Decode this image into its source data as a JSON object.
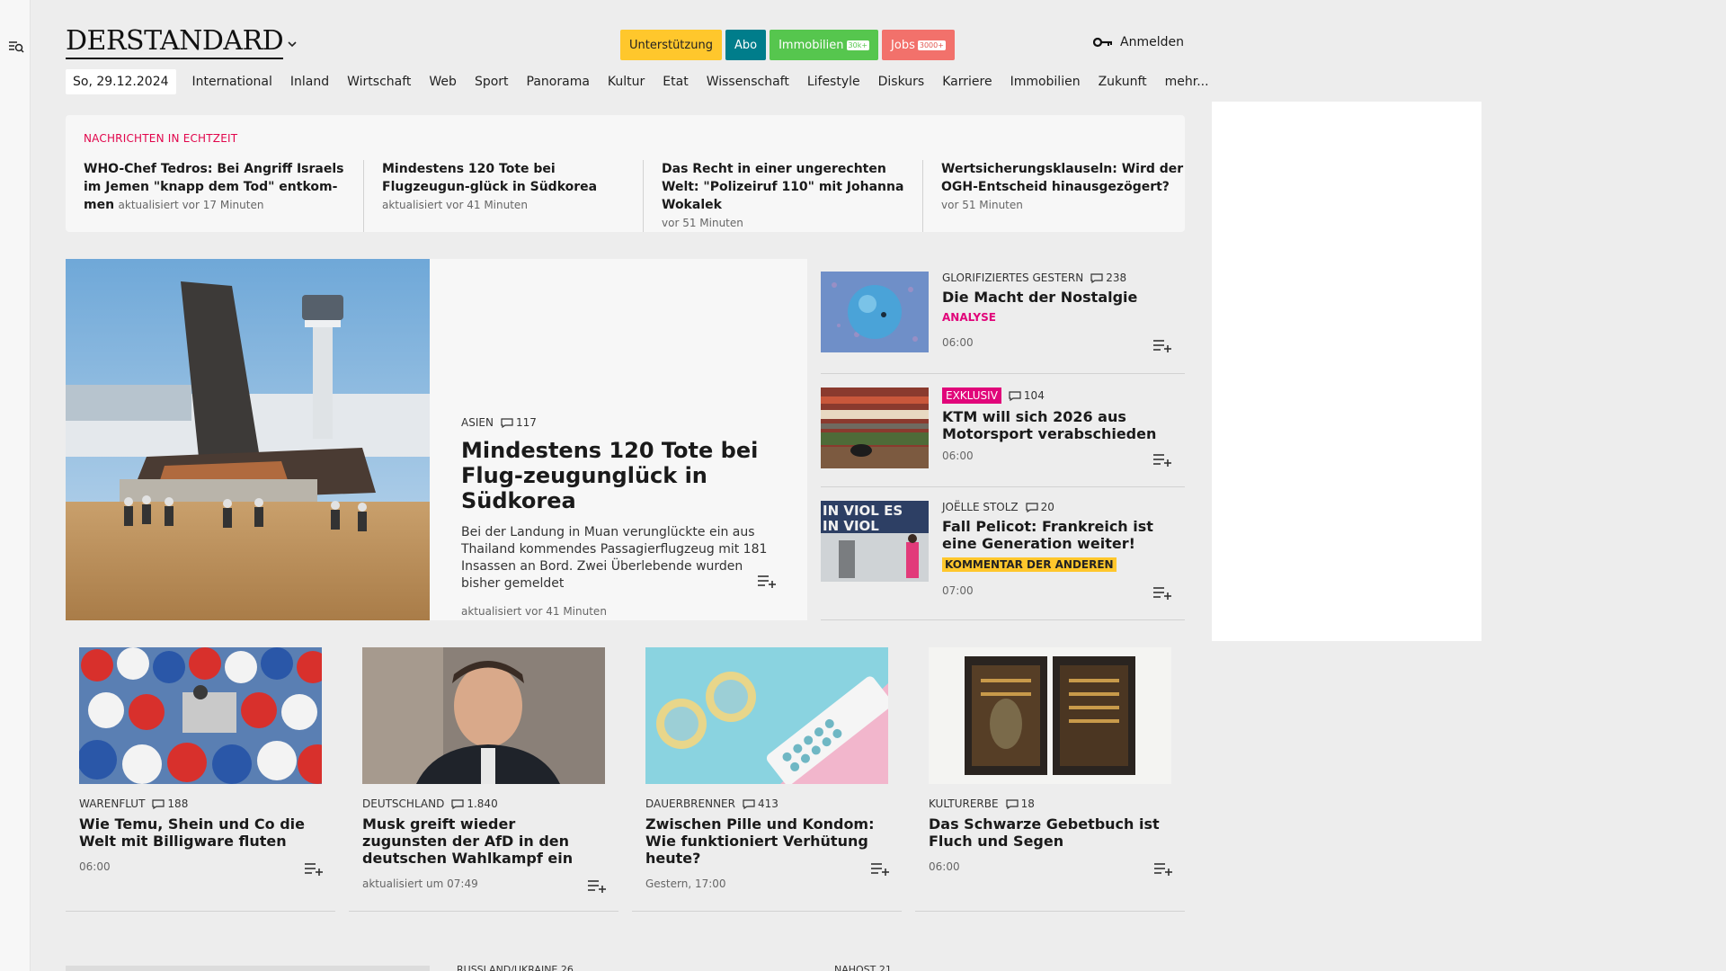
{
  "brand": {
    "logo": "DERSTANDARD"
  },
  "header": {
    "buttons": [
      {
        "label": "Unterstützung"
      },
      {
        "label": "Abo"
      },
      {
        "label": "Immobilien",
        "badge": "30k+"
      },
      {
        "label": "Jobs",
        "badge": "3000+"
      }
    ],
    "login": "Anmelden"
  },
  "nav": {
    "date": "So, 29.12.2024",
    "items": [
      "International",
      "Inland",
      "Wirtschaft",
      "Web",
      "Sport",
      "Panorama",
      "Kultur",
      "Etat",
      "Wissenschaft",
      "Lifestyle",
      "Diskurs",
      "Karriere",
      "Immobilien",
      "Zukunft",
      "mehr..."
    ]
  },
  "ticker": {
    "title": "NACHRICHTEN IN ECHTZEIT",
    "items": [
      {
        "headline": "WHO-Chef Tedros: Bei Angriff Israels im Jemen \"knapp dem Tod\" entkom-men",
        "meta": "aktualisiert vor 17 Minuten"
      },
      {
        "headline": "Mindestens 120 Tote bei Flugzeugun-glück in Südkorea",
        "meta": "aktualisiert vor 41 Minuten"
      },
      {
        "headline": "Das Recht in einer ungerechten Welt: \"Polizeiruf 110\" mit Johanna Wokalek",
        "meta": "vor 51 Minuten"
      },
      {
        "headline": "Wertsicherungsklauseln: Wird der OGH-Entscheid hinausgezögert?",
        "meta": "vor 51 Minuten"
      }
    ]
  },
  "feature": {
    "kicker": "ASIEN",
    "comments": "117",
    "title": "Mindestens 120 Tote bei Flug-zeugunglück in Südkorea",
    "lead": "Bei der Landung in Muan verunglückte ein aus Thailand kommendes Passagierflugzeug mit 181 Insassen an Bord. Zwei Überlebende wurden bisher gemeldet",
    "meta": "aktualisiert vor 41 Minuten"
  },
  "side": [
    {
      "kicker": "GLORIFIZIERTES GESTERN",
      "comments": "238",
      "title": "Die Macht der Nostalgie",
      "tag": "ANALYSE",
      "time": "06:00"
    },
    {
      "badge": "EXKLUSIV",
      "comments": "104",
      "title": "KTM will sich 2026 aus Motorsport verabschieden",
      "time": "06:00"
    },
    {
      "kicker": "JOËLLE STOLZ",
      "comments": "20",
      "title": "Fall Pelicot: Frankreich ist eine Generation weiter!",
      "tag": "KOMMENTAR DER ANDEREN",
      "time": "07:00"
    }
  ],
  "cards": [
    {
      "kicker": "WARENFLUT",
      "comments": "188",
      "title": "Wie Temu, Shein und Co die Welt mit Billigware fluten",
      "meta": "06:00"
    },
    {
      "kicker": "DEUTSCHLAND",
      "comments": "1.840",
      "title": "Musk greift wieder zugunsten der AfD in den deutschen Wahlkampf ein",
      "meta": "aktualisiert um 07:49"
    },
    {
      "kicker": "DAUERBRENNER",
      "comments": "413",
      "title": "Zwischen Pille und Kondom: Wie funktioniert Verhütung heute?",
      "meta": "Gestern, 17:00"
    },
    {
      "kicker": "KULTURERBE",
      "comments": "18",
      "title": "Das Schwarze Gebetbuch ist Fluch und Segen",
      "meta": "06:00"
    }
  ],
  "peek": [
    {
      "kicker": "RUSSLAND/UKRAINE",
      "comments": "26"
    },
    {
      "kicker": "NAHOST",
      "comments": "21"
    }
  ],
  "colors": {
    "accent_red": "#e1054b",
    "accent_pink": "#e1057a",
    "abo_teal": "#007d8b",
    "support_yellow": "#ffc72c",
    "immo_green": "#56c64e",
    "jobs_red": "#f2716b"
  }
}
